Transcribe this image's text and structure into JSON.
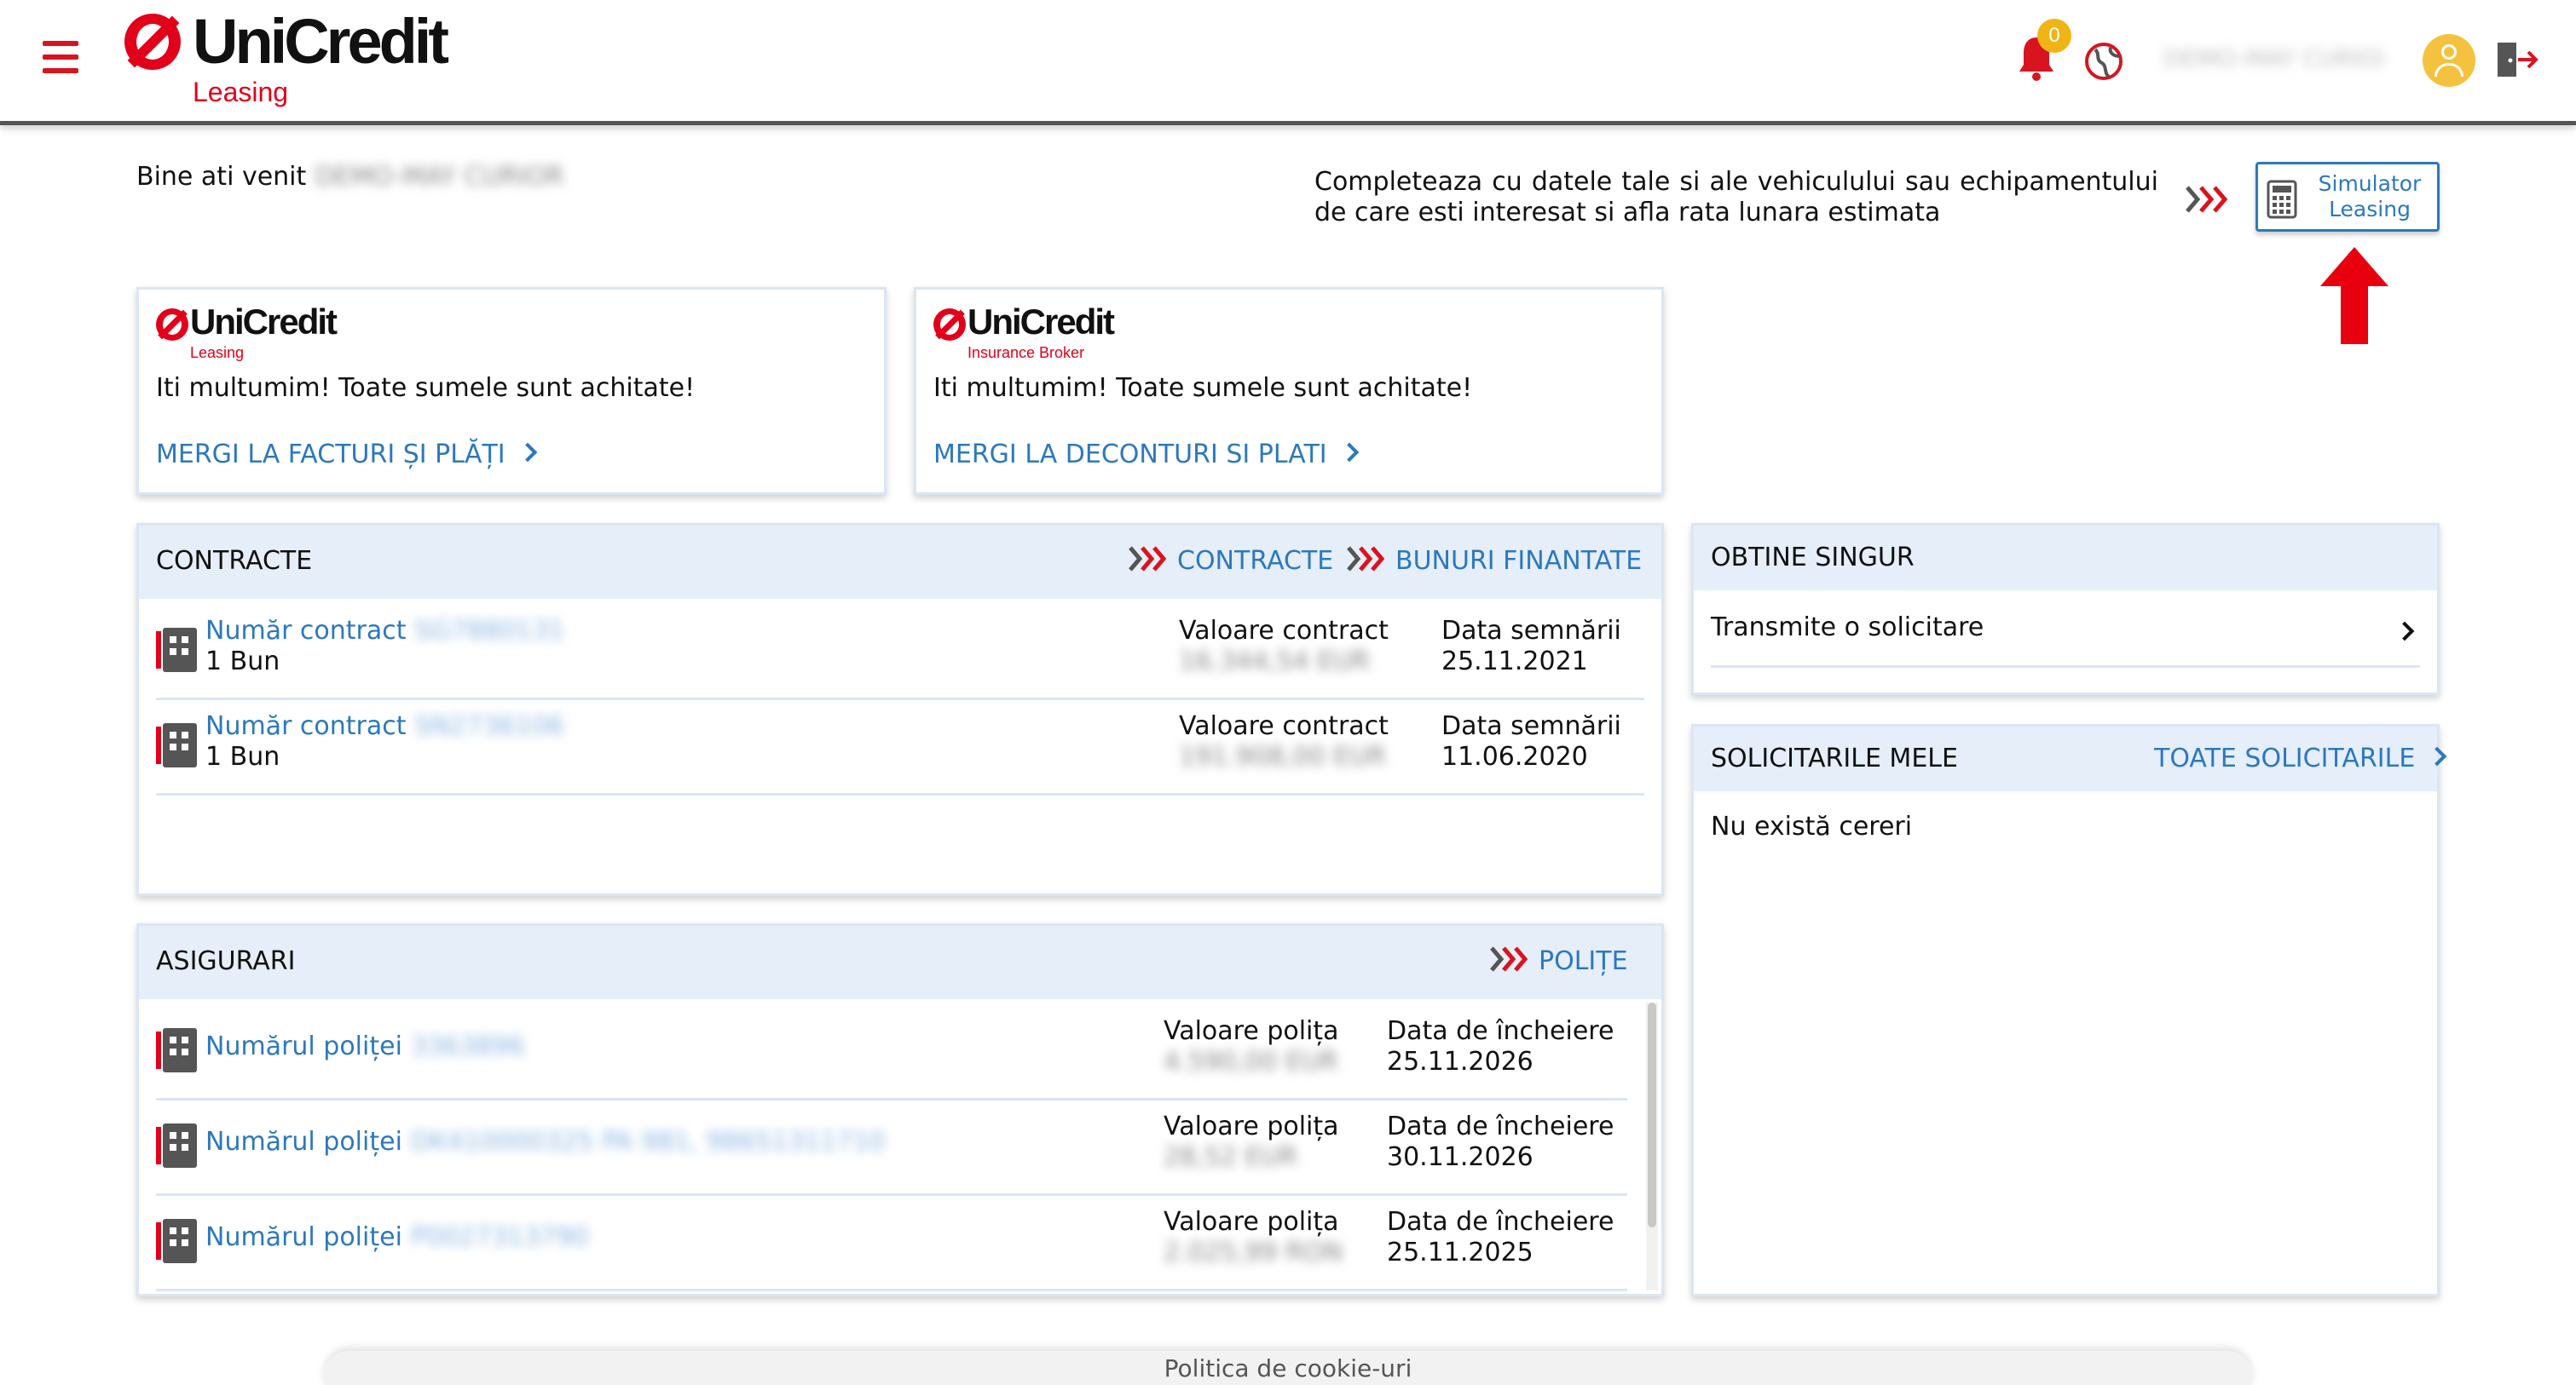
{
  "header": {
    "brand": {
      "name": "UniCredit",
      "sub": "Leasing"
    },
    "notification_count": "0",
    "user_name": "DEMO-MAY CURIOR"
  },
  "welcome": {
    "text": "Bine ati venit",
    "name": "DEMO-MAY CURIOR"
  },
  "simulator": {
    "description": "Completeaza cu datele tale si ale vehiculului sau echipamentului de care esti interesat si afla rata lunara estimata",
    "button_line1": "Simulator",
    "button_line2": "Leasing"
  },
  "cards": [
    {
      "brand": "UniCredit",
      "sub": "Leasing",
      "message": "Iti multumim! Toate sumele sunt achitate!",
      "link": "MERGI LA FACTURI ȘI PLĂȚI"
    },
    {
      "brand": "UniCredit",
      "sub": "Insurance Broker",
      "message": "Iti multumim! Toate sumele sunt achitate!",
      "link": "MERGI LA DECONTURI SI PLATI"
    }
  ],
  "contracts": {
    "title": "CONTRACTE",
    "links": [
      "CONTRACTE",
      "BUNURI FINANTATE"
    ],
    "rows": [
      {
        "label": "Număr contract",
        "number": "SG7880131",
        "sub": "1 Bun",
        "value_label": "Valoare contract",
        "value": "16.344,54 EUR",
        "date_label": "Data semnării",
        "date": "25.11.2021"
      },
      {
        "label": "Număr contract",
        "number": "SN2736106",
        "sub": "1 Bun",
        "value_label": "Valoare contract",
        "value": "191.908,00 EUR",
        "date_label": "Data semnării",
        "date": "11.06.2020"
      }
    ]
  },
  "insurance": {
    "title": "ASIGURARI",
    "link": "POLIȚE",
    "rows": [
      {
        "label": "Numărul poliței",
        "number": "3363896",
        "value_label": "Valoare polița",
        "value": "4.590,00 EUR",
        "date_label": "Data de încheiere",
        "date": "25.11.2026"
      },
      {
        "label": "Numărul poliței",
        "number": "DK410000325 PA 981, 98651311710",
        "value_label": "Valoare polița",
        "value": "28,52 EUR",
        "date_label": "Data de încheiere",
        "date": "30.11.2026"
      },
      {
        "label": "Numărul poliței",
        "number": "P0027313790",
        "value_label": "Valoare polița",
        "value": "2.025,99 RON",
        "date_label": "Data de încheiere",
        "date": "25.11.2025"
      }
    ]
  },
  "self_service": {
    "title": "OBTINE SINGUR",
    "item": "Transmite o solicitare"
  },
  "requests": {
    "title": "SOLICITARILE MELE",
    "link": "TOATE SOLICITARILE",
    "empty": "Nu există cereri"
  },
  "footer": {
    "text": "Politica de cookie-uri"
  },
  "colors": {
    "accent": "#2c78bf",
    "brand_red": "#e2001a",
    "panel_header": "#e5eef9",
    "badge": "#f0b515"
  }
}
